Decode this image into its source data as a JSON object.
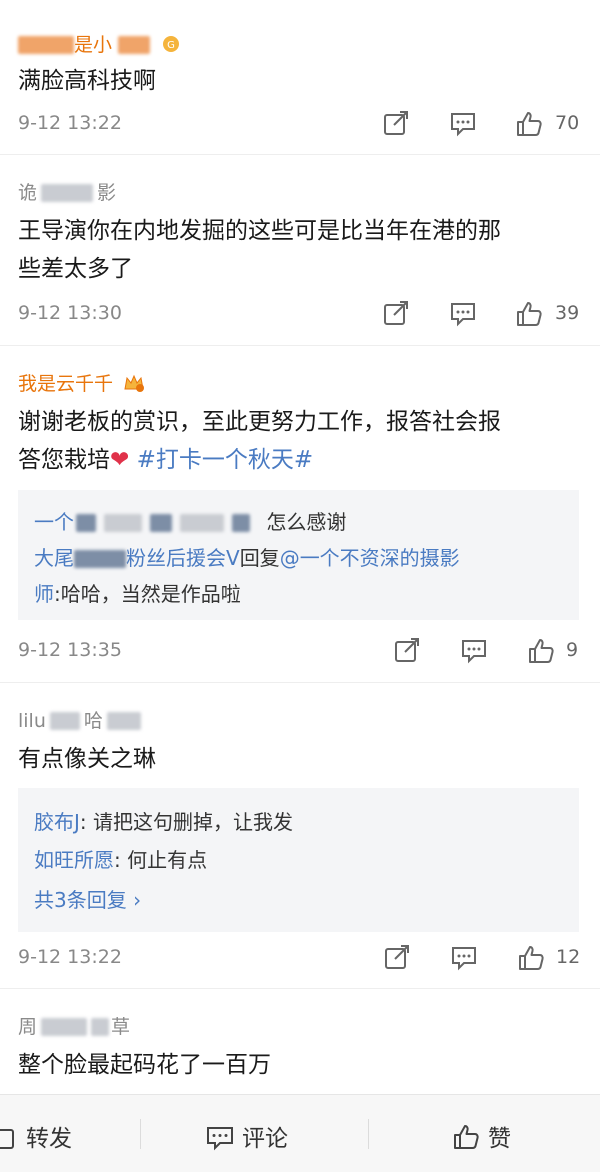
{
  "comments": [
    {
      "user_visible": "是小",
      "text": "满脸高科技啊",
      "time": "9-12 13:22",
      "likes": "70"
    },
    {
      "user_visible_1": "诡",
      "user_visible_2": "影",
      "text_line1": "王导演你在内地发掘的这些可是比当年在港的那",
      "text_line2": "些差太多了",
      "time": "9-12 13:30",
      "likes": "39"
    },
    {
      "user": "我是云千千",
      "text_line1": "谢谢老板的赏识，至此更努力工作，报答社会报",
      "text_line2": "答您栽培",
      "heart": "❤",
      "hashtag": "#打卡一个秋天#",
      "reply1_prefix": "一个",
      "reply1_text": "怎么感谢",
      "reply2_name_a": "大尾",
      "reply2_name_b": "粉丝后援会V",
      "reply2_mid": "回复",
      "reply2_mention": "@一个不资深的摄影",
      "reply2_cont_name": "师",
      "reply2_cont_text": ":哈哈，当然是作品啦",
      "time": "9-12 13:35",
      "likes": "9"
    },
    {
      "user_visible_1": "lilu",
      "user_visible_2": "哈",
      "text": "有点像关之琳",
      "reply1_name": "胶布J",
      "reply1_text": ": 请把这句删掉，让我发",
      "reply2_name": "如旺所愿",
      "reply2_text": ": 何止有点",
      "more_replies": "共3条回复 ›",
      "time": "9-12 13:22",
      "likes": "12"
    },
    {
      "user_visible_1": "周",
      "user_visible_2": "草",
      "text": "整个脸最起码花了一百万"
    }
  ],
  "bottom_bar": {
    "repost": "转发",
    "comment": "评论",
    "like": "赞"
  },
  "colors": {
    "link_blue": "#4a7bc2",
    "vip_orange": "#e8750c",
    "heart_red": "#e0324a"
  }
}
